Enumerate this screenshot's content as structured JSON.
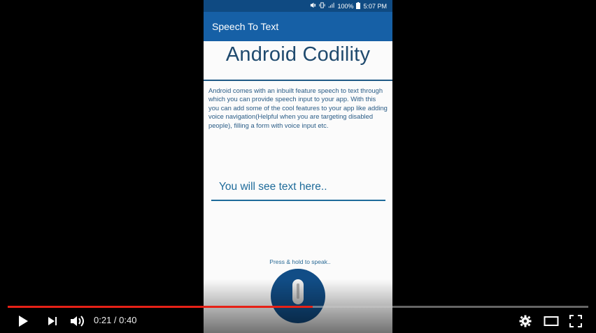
{
  "status_bar": {
    "battery": "100%",
    "time": "5:07 PM"
  },
  "app_bar": {
    "title": "Speech To Text"
  },
  "main": {
    "headline": "Android Codility",
    "description": "Android comes with an inbuilt feature speech to text through which you can provide speech input to your app. With this you can add some of the cool features to your app like adding voice navigation(Helpful when you are targeting disabled people), filling a form with voice input etc.",
    "speech_placeholder": "You will see text here..",
    "press_hint": "Press & hold to speak.."
  },
  "player": {
    "current_time": "0:21",
    "duration": "0:40",
    "time_label": "0:21 / 0:40",
    "progress_fraction": 0.525,
    "accent_color": "#e62117"
  },
  "icons": [
    "mute-icon",
    "vibrate-icon",
    "signal-icon",
    "battery-icon",
    "microphone-icon",
    "play-icon",
    "next-icon",
    "volume-icon",
    "gear-icon",
    "theater-mode-icon",
    "fullscreen-icon"
  ]
}
